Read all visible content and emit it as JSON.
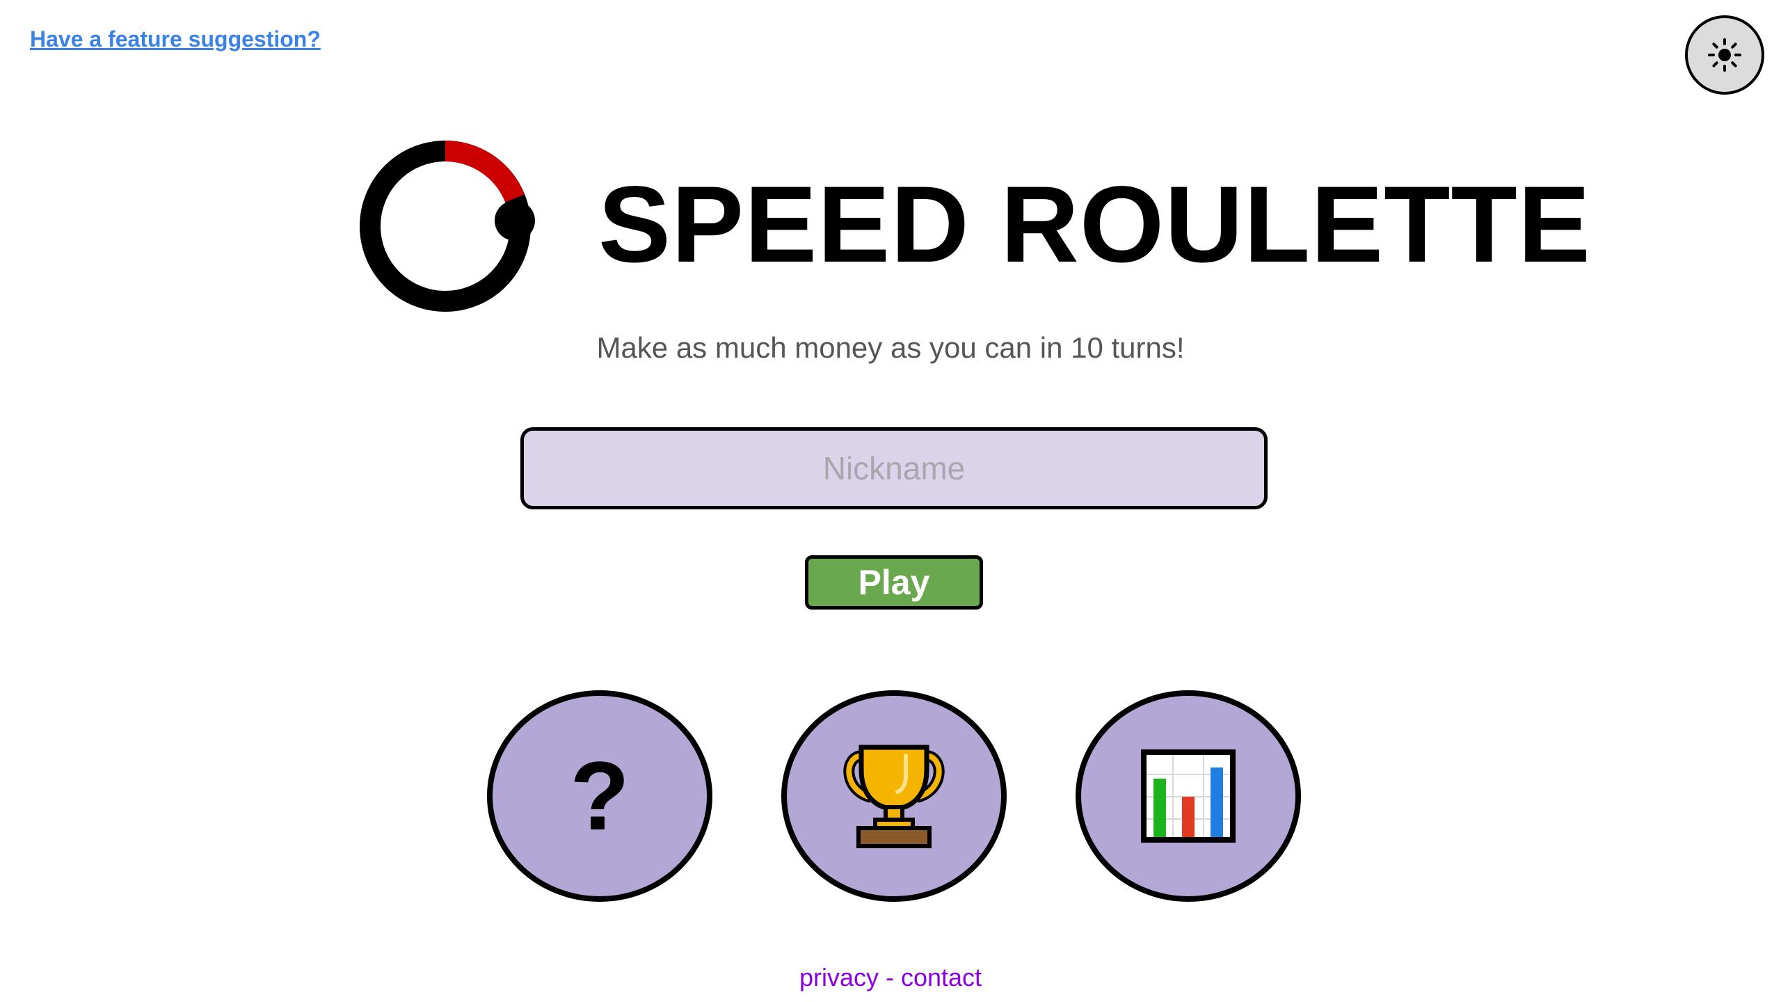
{
  "header": {
    "feature_link": "Have a feature suggestion?",
    "theme_toggle_icon": "sun-icon"
  },
  "hero": {
    "title": "SPEED ROULETTE",
    "tagline": "Make as much money as you can in 10 turns!",
    "logo_icon": "roulette-timer-icon"
  },
  "form": {
    "nickname_placeholder": "Nickname",
    "nickname_value": "",
    "play_label": "Play"
  },
  "actions": [
    {
      "name": "help",
      "icon": "question-mark-icon",
      "glyph": "?"
    },
    {
      "name": "leaderboard",
      "icon": "trophy-icon"
    },
    {
      "name": "stats",
      "icon": "bar-chart-icon"
    }
  ],
  "footer": {
    "privacy": "privacy",
    "separator": " - ",
    "contact": "contact"
  },
  "colors": {
    "link": "#3b82e6",
    "accent_purple": "#b3a7d6",
    "input_bg": "#dad3ea",
    "play_green": "#6aa84f",
    "logo_red": "#cc0000",
    "footer_link": "#8b00e0"
  }
}
